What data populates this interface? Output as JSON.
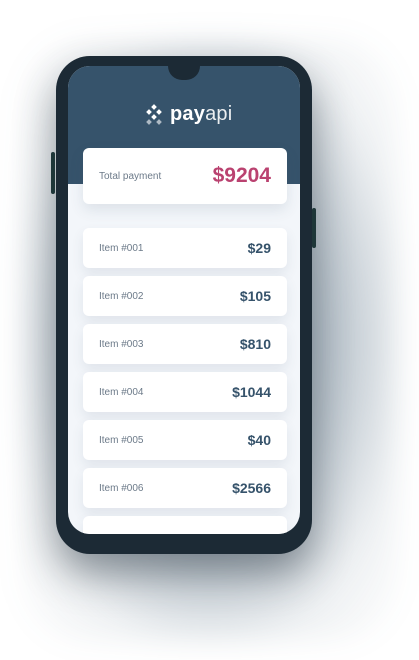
{
  "brand": {
    "name_bold": "pay",
    "name_light": "api",
    "logo_icon": "diamond-dots-icon"
  },
  "total": {
    "label": "Total payment",
    "value": "$9204"
  },
  "items": [
    {
      "label": "Item #001",
      "value": "$29"
    },
    {
      "label": "Item #002",
      "value": "$105"
    },
    {
      "label": "Item #003",
      "value": "$810"
    },
    {
      "label": "Item #004",
      "value": "$1044"
    },
    {
      "label": "Item #005",
      "value": "$40"
    },
    {
      "label": "Item #006",
      "value": "$2566"
    }
  ],
  "colors": {
    "header": "#36536b",
    "accent": "#ba4270",
    "device": "#1c2a35",
    "screen_bg": "#f3f6fa"
  }
}
